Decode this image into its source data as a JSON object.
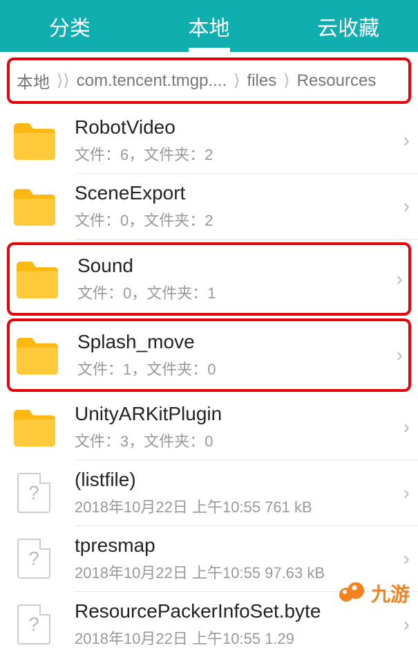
{
  "tabs": {
    "categories": "分类",
    "local": "本地",
    "cloud": "云收藏"
  },
  "breadcrumb": {
    "items": [
      "本地",
      "com.tencent.tmgp....",
      "files",
      "Resources"
    ]
  },
  "items": [
    {
      "type": "folder",
      "name": "RobotVideo",
      "sub": "文件：6，文件夹：2",
      "highlight": false
    },
    {
      "type": "folder",
      "name": "SceneExport",
      "sub": "文件：0，文件夹：2",
      "highlight": false
    },
    {
      "type": "folder",
      "name": "Sound",
      "sub": "文件：0，文件夹：1",
      "highlight": true
    },
    {
      "type": "folder",
      "name": "Splash_move",
      "sub": "文件：1，文件夹：0",
      "highlight": true
    },
    {
      "type": "folder",
      "name": "UnityARKitPlugin",
      "sub": "文件：3，文件夹：0",
      "highlight": false
    },
    {
      "type": "file",
      "name": "(listfile)",
      "sub": "2018年10月22日 上午10:55 761 kB",
      "highlight": false
    },
    {
      "type": "file",
      "name": "tpresmap",
      "sub": "2018年10月22日 上午10:55 97.63 kB",
      "highlight": false
    },
    {
      "type": "file",
      "name": "ResourcePackerInfoSet.byte",
      "sub": "2018年10月22日 上午10:55 1.29",
      "highlight": false
    }
  ],
  "watermark": {
    "text": "九游"
  }
}
